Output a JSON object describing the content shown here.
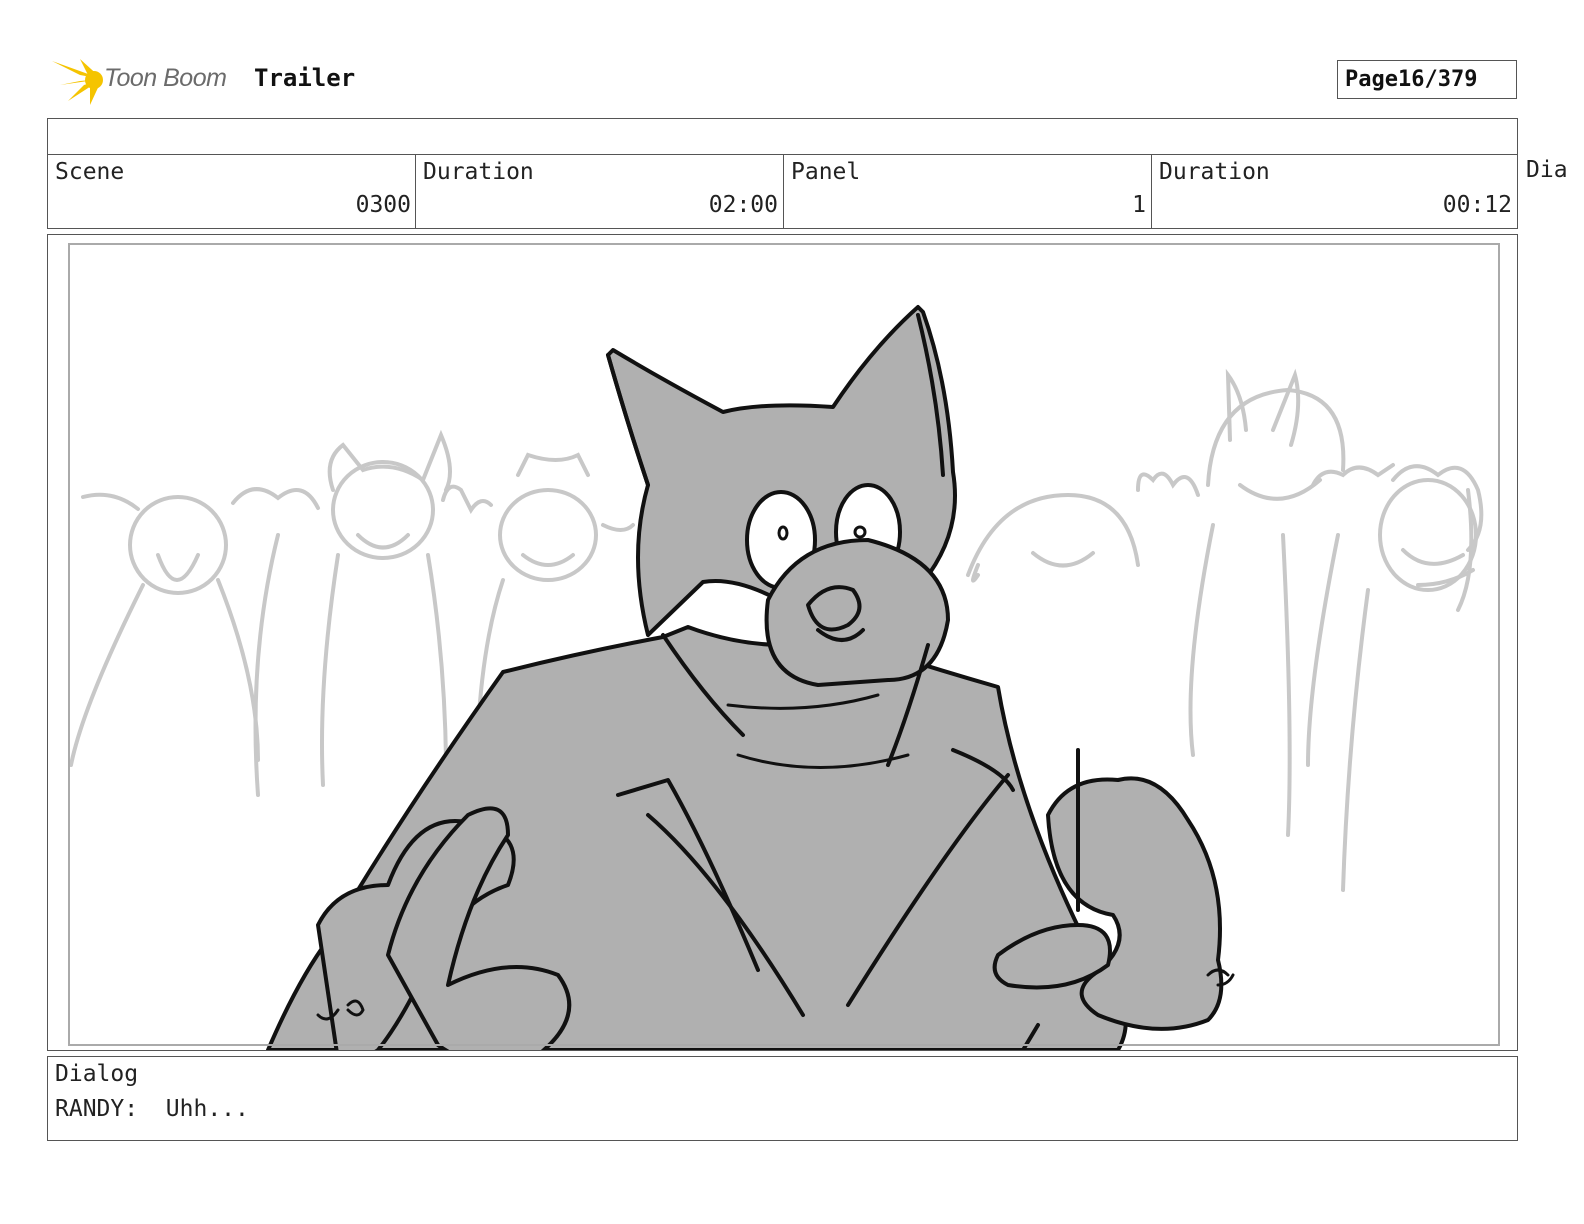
{
  "header": {
    "logo_text": "Toon Boom",
    "project_title": "Trailer",
    "page_label": "Page",
    "page_value": "16/379"
  },
  "info": {
    "cells": [
      {
        "label": "Scene",
        "value": "0300"
      },
      {
        "label": "Duration",
        "value": "02:00"
      },
      {
        "label": "Panel",
        "value": "1"
      },
      {
        "label": "Duration",
        "value": "00:12"
      }
    ],
    "overflow_label": "Dia"
  },
  "dialog": {
    "label": "Dialog",
    "text": "RANDY:  Uhh..."
  },
  "colors": {
    "logo_yellow": "#f5c400",
    "character_fill": "#b0b0b0",
    "background_sketch": "#c8c8c8"
  }
}
